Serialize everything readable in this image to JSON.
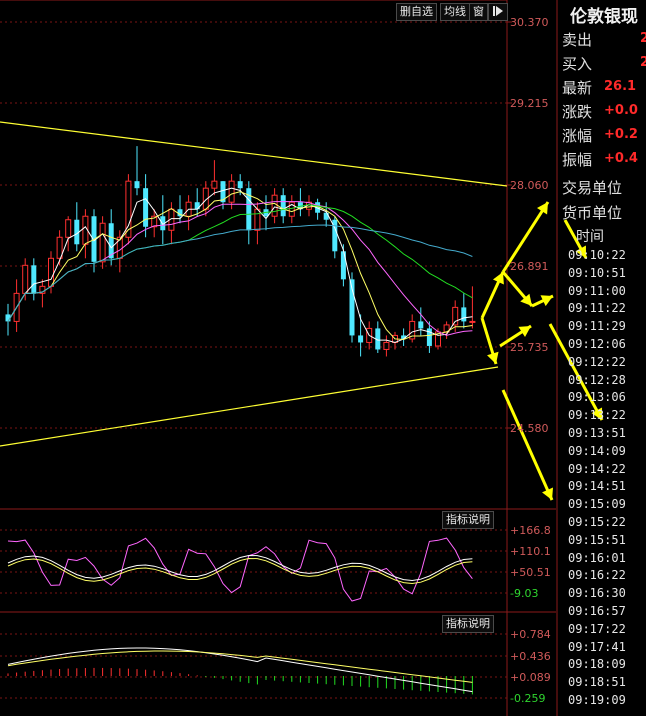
{
  "toolbar": {
    "delete_watch": "删自选",
    "ma_line": "均线",
    "window": "窗",
    "play_icon": "play-icon"
  },
  "main_axis": {
    "labels": [
      "30.370",
      "29.215",
      "28.060",
      "26.891",
      "25.735",
      "24.580"
    ]
  },
  "osc1": {
    "legend_btn": "指标说明",
    "labels": [
      "+166.8",
      "+110.1",
      "+50.51",
      "-9.03"
    ]
  },
  "osc2": {
    "legend_btn": "指标说明",
    "labels": [
      "+0.784",
      "+0.436",
      "+0.089",
      "-0.259"
    ]
  },
  "side": {
    "title": "伦敦银现",
    "rows": [
      {
        "label": "卖出",
        "value": "2"
      },
      {
        "label": "买入",
        "value": "2"
      },
      {
        "label": "最新",
        "value": "26.1"
      },
      {
        "label": "涨跌",
        "value": "+0.0"
      },
      {
        "label": "涨幅",
        "value": "+0.2"
      },
      {
        "label": "振幅",
        "value": "+0.4"
      }
    ],
    "trade_unit_label": "交易单位",
    "currency_unit_label": "货币单位",
    "time_header": "时间",
    "times": [
      "09:10:22",
      "09:10:51",
      "09:11:00",
      "09:11:22",
      "09:11:29",
      "09:12:06",
      "09:12:22",
      "09:12:28",
      "09:13:06",
      "09:13:22",
      "09:13:51",
      "09:14:09",
      "09:14:22",
      "09:14:51",
      "09:15:09",
      "09:15:22",
      "09:15:51",
      "09:16:01",
      "09:16:22",
      "09:16:30",
      "09:16:57",
      "09:17:22",
      "09:17:41",
      "09:18:09",
      "09:18:51",
      "09:19:09"
    ]
  },
  "colors": {
    "up": "#ff3030",
    "down": "#4fe8ff",
    "ma5": "#ffffff",
    "ma10": "#ffff66",
    "ma20": "#ff66ff",
    "ma40": "#22dd22",
    "ma60": "#44aacc",
    "trend": "#ffff33",
    "arrow": "#ffff00"
  },
  "chart_data": {
    "type": "candlestick",
    "price_axis_ticks": [
      30.37,
      29.215,
      28.06,
      26.891,
      25.735,
      24.58
    ],
    "candles": [
      [
        26.2,
        26.35,
        25.9,
        26.1
      ],
      [
        26.1,
        26.7,
        25.95,
        26.5
      ],
      [
        26.5,
        27.0,
        26.4,
        26.9
      ],
      [
        26.9,
        27.0,
        26.4,
        26.5
      ],
      [
        26.5,
        26.7,
        26.3,
        26.6
      ],
      [
        26.6,
        27.1,
        26.5,
        27.0
      ],
      [
        27.0,
        27.4,
        26.9,
        27.3
      ],
      [
        27.3,
        27.6,
        27.1,
        27.55
      ],
      [
        27.55,
        27.8,
        27.1,
        27.2
      ],
      [
        27.2,
        27.7,
        27.0,
        27.6
      ],
      [
        27.6,
        27.7,
        26.8,
        26.95
      ],
      [
        26.95,
        27.6,
        26.85,
        27.5
      ],
      [
        27.5,
        27.7,
        26.9,
        27.0
      ],
      [
        27.0,
        27.4,
        26.8,
        27.3
      ],
      [
        27.3,
        28.2,
        27.2,
        28.1
      ],
      [
        28.1,
        28.6,
        27.9,
        28.0
      ],
      [
        28.0,
        28.2,
        27.3,
        27.45
      ],
      [
        27.45,
        27.7,
        27.3,
        27.6
      ],
      [
        27.6,
        27.9,
        27.2,
        27.4
      ],
      [
        27.4,
        27.8,
        27.2,
        27.7
      ],
      [
        27.7,
        27.9,
        27.5,
        27.6
      ],
      [
        27.6,
        27.9,
        27.4,
        27.8
      ],
      [
        27.8,
        28.0,
        27.6,
        27.7
      ],
      [
        27.7,
        28.1,
        27.6,
        28.0
      ],
      [
        28.0,
        28.4,
        27.9,
        28.1
      ],
      [
        28.1,
        28.1,
        27.7,
        27.8
      ],
      [
        27.8,
        28.2,
        27.7,
        28.1
      ],
      [
        28.1,
        28.2,
        27.9,
        28.0
      ],
      [
        28.0,
        28.1,
        27.2,
        27.4
      ],
      [
        27.4,
        27.8,
        27.2,
        27.7
      ],
      [
        27.7,
        27.9,
        27.4,
        27.6
      ],
      [
        27.6,
        28.0,
        27.5,
        27.9
      ],
      [
        27.9,
        28.0,
        27.5,
        27.6
      ],
      [
        27.6,
        27.9,
        27.5,
        27.8
      ],
      [
        27.8,
        28.0,
        27.6,
        27.7
      ],
      [
        27.7,
        27.9,
        27.6,
        27.8
      ],
      [
        27.8,
        27.85,
        27.55,
        27.65
      ],
      [
        27.65,
        27.8,
        27.45,
        27.55
      ],
      [
        27.55,
        27.6,
        27.0,
        27.1
      ],
      [
        27.1,
        27.2,
        26.6,
        26.7
      ],
      [
        26.7,
        26.8,
        25.8,
        25.9
      ],
      [
        25.9,
        26.2,
        25.6,
        25.8
      ],
      [
        25.8,
        26.1,
        25.7,
        26.0
      ],
      [
        26.0,
        26.1,
        25.65,
        25.7
      ],
      [
        25.7,
        25.9,
        25.6,
        25.8
      ],
      [
        25.8,
        25.95,
        25.7,
        25.9
      ],
      [
        25.9,
        26.0,
        25.75,
        25.85
      ],
      [
        25.85,
        26.2,
        25.8,
        26.1
      ],
      [
        26.1,
        26.3,
        25.9,
        26.0
      ],
      [
        26.0,
        26.1,
        25.65,
        25.75
      ],
      [
        25.75,
        26.0,
        25.7,
        25.95
      ],
      [
        25.95,
        26.1,
        25.85,
        26.05
      ],
      [
        26.05,
        26.4,
        25.95,
        26.3
      ],
      [
        26.3,
        26.5,
        26.0,
        26.1
      ],
      [
        26.1,
        26.6,
        26.0,
        26.1
      ]
    ]
  }
}
